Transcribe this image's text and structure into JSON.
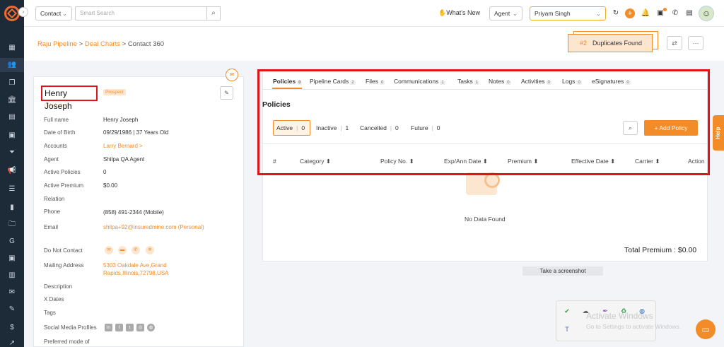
{
  "header": {
    "module_select": "Contact",
    "search_placeholder": "Smart Search",
    "whats_new": "What's New",
    "role_select": "Agent",
    "user_select": "Priyam Singh"
  },
  "breadcrumb": {
    "part1": "Raju Pipeline",
    "sep1": " > ",
    "part2": "Deal Charts",
    "sep2": " > ",
    "part3": "Contact 360"
  },
  "duplicates": {
    "count": "#2",
    "label": "Duplicates Found"
  },
  "contact": {
    "name": "Henry Joseph",
    "badge": "Prospect",
    "stars": "☆☆☆☆☆",
    "fields": [
      {
        "label": "Full name",
        "value": "Henry Joseph"
      },
      {
        "label": "Date of Birth",
        "value": "09/29/1986 | 37 Years Old"
      },
      {
        "label": "Accounts",
        "value": "Larry Bernard >"
      },
      {
        "label": "Agent",
        "value": "Shilpa QA Agent"
      },
      {
        "label": "Active Policies",
        "value": "0"
      },
      {
        "label": "Active Premium",
        "value": "$0.00"
      },
      {
        "label": "Relation",
        "value": ""
      },
      {
        "label": "Phone",
        "value": "(858) 491-2344 (Mobile)"
      },
      {
        "label": "Email",
        "value": "shilpa+92@insuredmine.com  (Personal)"
      },
      {
        "label": "Do Not Contact",
        "value": ""
      },
      {
        "label": "Mailing Address",
        "value_line1": "5303 Oakdale Ave,Grand",
        "value_line2": "Rapids,Illinois,72798,USA"
      },
      {
        "label": "Description",
        "value": ""
      },
      {
        "label": "X Dates",
        "value": ""
      },
      {
        "label": "Tags",
        "value": ""
      },
      {
        "label": "Social Media Profiles",
        "value": ""
      },
      {
        "label": "Preferred mode of",
        "value": ""
      }
    ]
  },
  "tabs": [
    {
      "label": "Policies",
      "count": "0"
    },
    {
      "label": "Pipeline Cards",
      "count": "2"
    },
    {
      "label": "Files",
      "count": "0"
    },
    {
      "label": "Communications",
      "count": "1"
    },
    {
      "label": "Tasks",
      "count": "1"
    },
    {
      "label": "Notes",
      "count": "0"
    },
    {
      "label": "Activities",
      "count": "0"
    },
    {
      "label": "Logs",
      "count": "0"
    },
    {
      "label": "eSignatures",
      "count": "0"
    }
  ],
  "policies": {
    "title": "Policies",
    "filters": [
      {
        "label": "Active",
        "count": "0"
      },
      {
        "label": "Inactive",
        "count": "1"
      },
      {
        "label": "Cancelled",
        "count": "0"
      },
      {
        "label": "Future",
        "count": "0"
      }
    ],
    "add_button": "+ Add Policy",
    "columns": [
      "#",
      "Category ⬍",
      "Policy No. ⬍",
      "Exp/Ann Date ⬍",
      "Premium ⬍",
      "Effective Date ⬍",
      "Carrier ⬍",
      "Action"
    ],
    "empty_text": "No Data Found",
    "total": "Total Premium : $0.00"
  },
  "screenshot_label": "Take a screenshot",
  "help_label": "Help",
  "watermark": {
    "line1": "Activate Windows",
    "line2": "Go to Settings to activate Windows."
  },
  "colors": {
    "accent": "#f28c28",
    "sidebar": "#1d2a38",
    "highlight": "#e1141b"
  }
}
